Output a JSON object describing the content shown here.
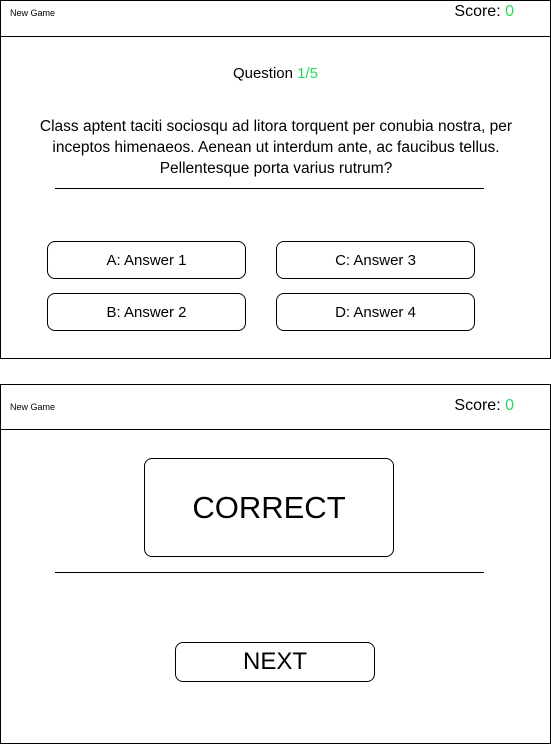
{
  "question_screen": {
    "header": {
      "new_game_label": "New Game",
      "score_label": "Score:",
      "score_value": "0"
    },
    "question_label": "Question",
    "question_number": "1/5",
    "question_text": "Class aptent taciti sociosqu ad litora torquent per conubia nostra, per inceptos himenaeos. Aenean ut interdum ante, ac faucibus tellus. Pellentesque porta varius rutrum?",
    "answers": [
      {
        "label": "A: Answer 1"
      },
      {
        "label": "C: Answer 3"
      },
      {
        "label": "B: Answer 2"
      },
      {
        "label": "D: Answer 4"
      }
    ]
  },
  "result_screen": {
    "header": {
      "new_game_label": "New Game",
      "score_label": "Score:",
      "score_value": "0"
    },
    "result_text": "CORRECT",
    "next_label": "NEXT"
  },
  "colors": {
    "accent_green": "#28d860",
    "border": "#000000",
    "background": "#ffffff"
  }
}
